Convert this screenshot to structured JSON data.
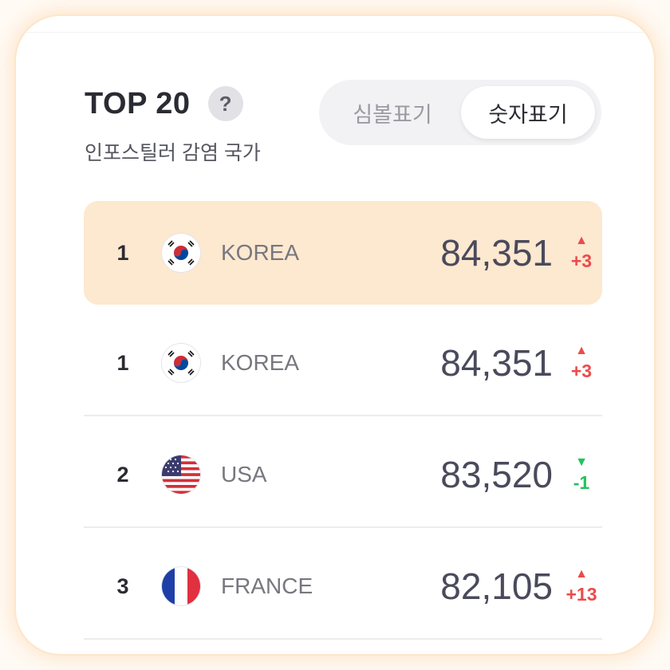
{
  "header": {
    "title": "TOP 20",
    "help_icon": "?",
    "subtitle": "인포스틸러 감염 국가"
  },
  "toggle": {
    "symbol_label": "심볼표기",
    "number_label": "숫자표기",
    "selected": "숫자표기"
  },
  "colors": {
    "highlight_row": "#fde8d0",
    "increase": "#ec4b4b",
    "decrease": "#22c35e"
  },
  "rows": [
    {
      "rank": "1",
      "flag": "korea-flag-icon",
      "country": "KOREA",
      "value": "84,351",
      "direction": "up",
      "arrow": "▲",
      "change": "+3",
      "highlighted": true
    },
    {
      "rank": "1",
      "flag": "korea-flag-icon",
      "country": "KOREA",
      "value": "84,351",
      "direction": "up",
      "arrow": "▲",
      "change": "+3",
      "highlighted": false
    },
    {
      "rank": "2",
      "flag": "usa-flag-icon",
      "country": "USA",
      "value": "83,520",
      "direction": "down",
      "arrow": "▼",
      "change": "-1",
      "highlighted": false
    },
    {
      "rank": "3",
      "flag": "france-flag-icon",
      "country": "FRANCE",
      "value": "82,105",
      "direction": "up",
      "arrow": "▲",
      "change": "+13",
      "highlighted": false
    }
  ]
}
